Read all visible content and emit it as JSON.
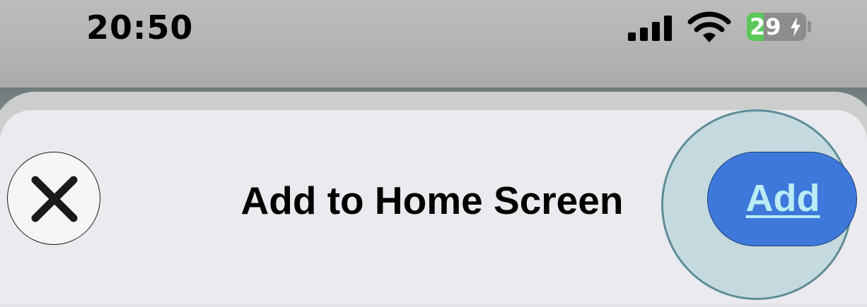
{
  "status_bar": {
    "time": "20:50",
    "battery_level": "29",
    "battery_charging": true,
    "signal_icon": "cellular-signal-icon",
    "wifi_icon": "wifi-icon"
  },
  "sheet": {
    "title": "Add to Home Screen",
    "close_icon": "close-icon",
    "add_label": "Add"
  },
  "colors": {
    "add_button": "#3e78da",
    "add_label": "#b9ecf5",
    "battery_fill": "#5ac85a",
    "sheet_background": "#ebeaef"
  }
}
